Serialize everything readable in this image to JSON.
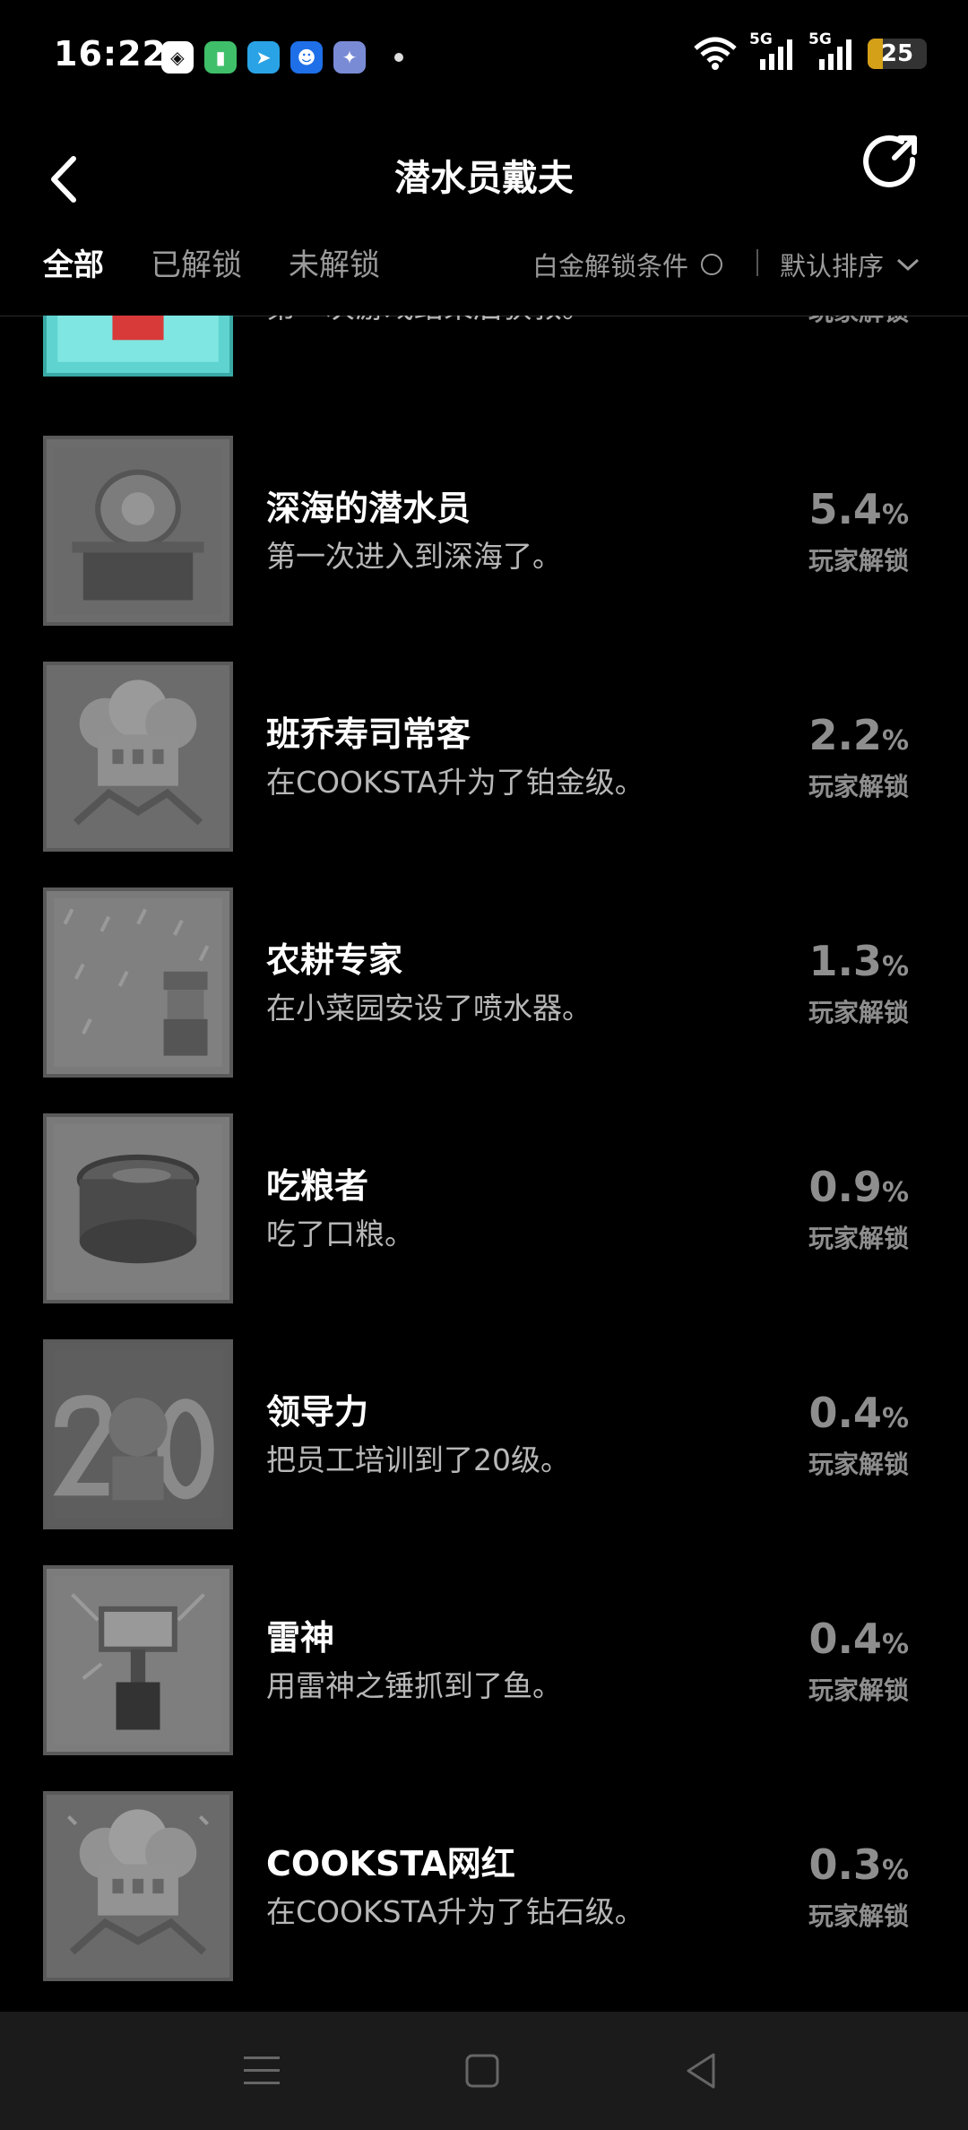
{
  "status": {
    "time": "16:22",
    "battery": "25",
    "battery_level": 0.25,
    "net1": "5G",
    "net2": "5G"
  },
  "header": {
    "title": "潜水员戴夫"
  },
  "tabs": [
    {
      "label": "全部",
      "active": true
    },
    {
      "label": "已解锁",
      "active": false
    },
    {
      "label": "未解锁",
      "active": false
    }
  ],
  "filter": {
    "platinum_label": "白金解锁条件",
    "sort_label": "默认排序"
  },
  "pct_suffix": "%",
  "pct_label": "玩家解锁",
  "achievements": [
    {
      "title": "",
      "desc": "第一次游戏结束后获救。",
      "pct": "",
      "pct_label": "玩家解锁",
      "icon": "rescue-cross-icon"
    },
    {
      "title": "深海的潜水员",
      "desc": "第一次进入到深海了。",
      "pct": "5.4",
      "icon": "deep-sea-diver-icon"
    },
    {
      "title": "班乔寿司常客",
      "desc": "在COOKSTA升为了铂金级。",
      "pct": "2.2",
      "icon": "chef-hat-icon"
    },
    {
      "title": "农耕专家",
      "desc": "在小菜园安设了喷水器。",
      "pct": "1.3",
      "icon": "farmer-rain-icon"
    },
    {
      "title": "吃粮者",
      "desc": "吃了口粮。",
      "pct": "0.9",
      "icon": "ration-can-icon"
    },
    {
      "title": "领导力",
      "desc": "把员工培训到了20级。",
      "pct": "0.4",
      "icon": "level-20-icon"
    },
    {
      "title": "雷神",
      "desc": "用雷神之锤抓到了鱼。",
      "pct": "0.4",
      "icon": "thor-hammer-icon"
    },
    {
      "title": "COOKSTA网红",
      "desc": "在COOKSTA升为了钻石级。",
      "pct": "0.3",
      "icon": "chef-hat-diamond-icon"
    }
  ]
}
